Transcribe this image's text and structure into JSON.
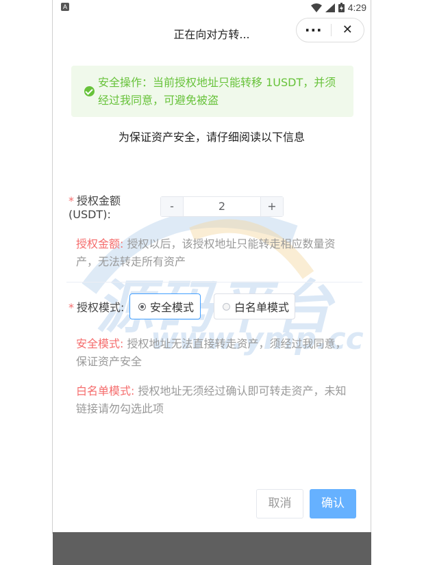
{
  "status_bar": {
    "time": "4:29",
    "app_badge": "A"
  },
  "header": {
    "title": "正在向对方转...",
    "more_label": "···",
    "close_label": "✕"
  },
  "notice": {
    "icon": "check-circle-icon",
    "text": "安全操作：当前授权地址只能转移 1USDT，并须经过我同意，可避免被盗"
  },
  "subtitle": "为保证资产安全，请仔细阅读以下信息",
  "watermark": {
    "main": "源码平台",
    "sub": "www.ymp.cc"
  },
  "amount": {
    "required_mark": "*",
    "label": "授权金额(USDT):",
    "minus": "-",
    "value": "2",
    "plus": "+",
    "desc_highlight": "授权金额:",
    "desc_text": " 授权以后，该授权地址只能转走相应数量资产，无法转走所有资产"
  },
  "mode": {
    "required_mark": "*",
    "label": "授权模式:",
    "options": [
      {
        "label": "安全模式",
        "selected": true
      },
      {
        "label": "白名单模式",
        "selected": false
      }
    ],
    "safe_highlight": "安全模式:",
    "safe_text": " 授权地址无法直接转走资产，须经过我同意，保证资产安全",
    "white_highlight": "白名单模式:",
    "white_text": " 授权地址无须经过确认即可转走资产，未知链接请勿勾选此项"
  },
  "actions": {
    "cancel": "取消",
    "confirm": "确认"
  },
  "colors": {
    "success": "#67c23a",
    "danger": "#f56c6c",
    "primary": "#66b1ff",
    "nav": "#5f5f5f"
  }
}
